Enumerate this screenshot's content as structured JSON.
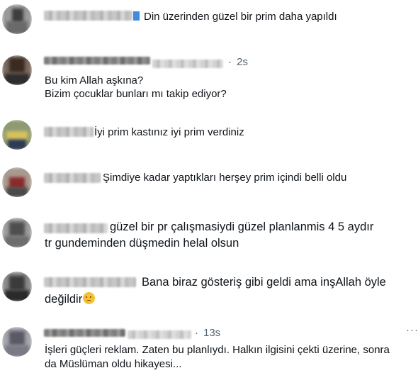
{
  "comments": [
    {
      "time": "",
      "lines": [
        "Din üzerinden güzel bir prim daha yapıldı"
      ]
    },
    {
      "time": "2s",
      "lines": [
        "Bu kim Allah aşkına?",
        "Bizim çocuklar bunları mı takip ediyor?"
      ]
    },
    {
      "time": "",
      "lines": [
        "İyi prim kastınız iyi prim verdiniz"
      ]
    },
    {
      "time": "",
      "lines": [
        "Şimdiye kadar yaptıkları herşey prim içindi belli oldu"
      ]
    },
    {
      "time": "",
      "lines": [
        "güzel bir pr çalışmasiydi güzel planlanmis 4 5 aydır",
        "tr gundeminden düşmedin helal olsun"
      ]
    },
    {
      "time": "",
      "lines": [
        "Bana biraz gösteriş gibi geldi ama inşAllah öyle",
        "değildir"
      ]
    },
    {
      "time": "13s",
      "lines": [
        "İşleri güçleri reklam. Zaten bu planlıydı. Halkın ilgisini çekti üzerine, sonra",
        "da Müslüman oldu hikayesi..."
      ]
    }
  ],
  "icons": {
    "flag": "blue-flag-icon",
    "emoji": "sad-face-emoji-icon",
    "more": "more-options-icon"
  },
  "colors": {
    "text": "#0f1419",
    "muted": "#536471",
    "background": "#ffffff"
  }
}
